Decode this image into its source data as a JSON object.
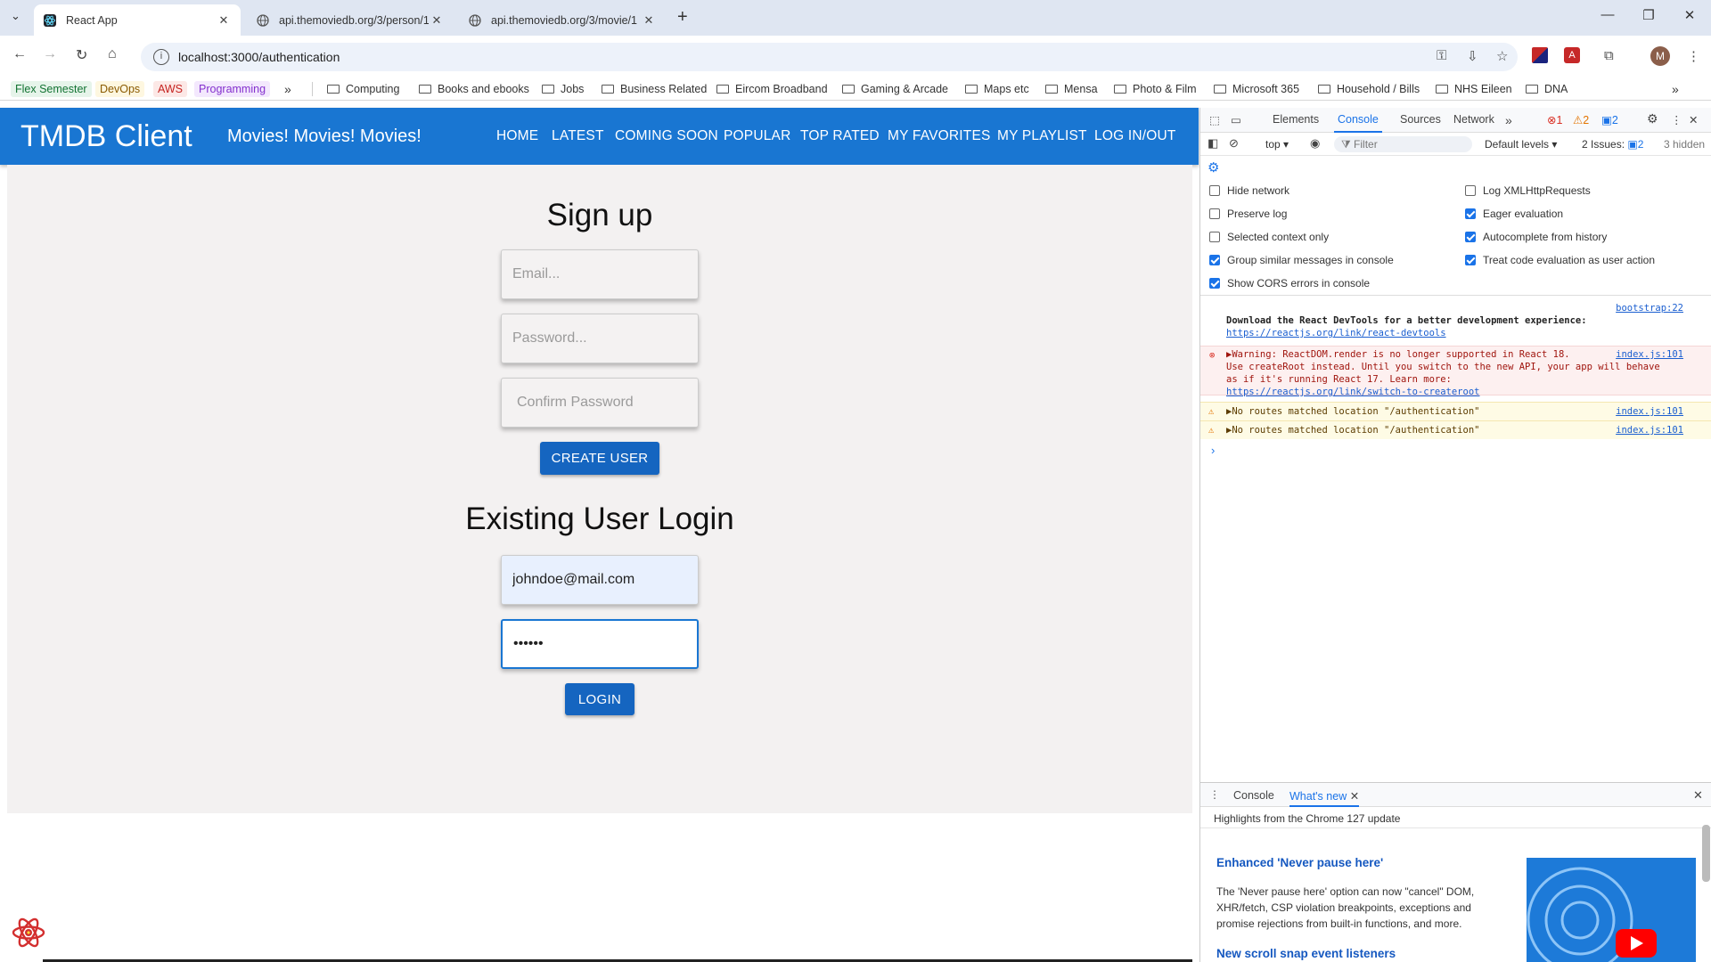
{
  "browser": {
    "tabs": [
      {
        "title": "React App",
        "active": true
      },
      {
        "title": "api.themoviedb.org/3/person/1",
        "active": false
      },
      {
        "title": "api.themoviedb.org/3/movie/1",
        "active": false
      }
    ],
    "url": "localhost:3000/authentication",
    "profile_initial": "M",
    "bookmarks": [
      {
        "label": "Flex Semester",
        "type": "chip",
        "color": "#e6f4ea",
        "text": "#137333"
      },
      {
        "label": "DevOps",
        "type": "chip",
        "color": "#fef7e0",
        "text": "#8a5a00"
      },
      {
        "label": "AWS",
        "type": "chip",
        "color": "#fce8e6",
        "text": "#c5221f"
      },
      {
        "label": "Programming",
        "type": "chip",
        "color": "#f3e8fd",
        "text": "#8430ce"
      },
      {
        "label": "Computing",
        "type": "folder"
      },
      {
        "label": "Books and ebooks",
        "type": "folder"
      },
      {
        "label": "Jobs",
        "type": "folder"
      },
      {
        "label": "Business Related",
        "type": "folder"
      },
      {
        "label": "Eircom Broadband",
        "type": "folder"
      },
      {
        "label": "Gaming & Arcade",
        "type": "folder"
      },
      {
        "label": "Maps etc",
        "type": "folder"
      },
      {
        "label": "Mensa",
        "type": "folder"
      },
      {
        "label": "Photo & Film",
        "type": "folder"
      },
      {
        "label": "Microsoft 365",
        "type": "folder"
      },
      {
        "label": "Household / Bills",
        "type": "folder"
      },
      {
        "label": "NHS Eileen",
        "type": "folder"
      },
      {
        "label": "DNA",
        "type": "folder"
      }
    ]
  },
  "app": {
    "brand": "TMDB Client",
    "tagline": "Movies! Movies! Movies!",
    "nav": [
      "HOME",
      "LATEST",
      "COMING SOON",
      "POPULAR",
      "TOP RATED",
      "MY FAVORITES",
      "MY PLAYLIST",
      "LOG IN/OUT"
    ],
    "header_color": "#1976d2",
    "signup": {
      "heading": "Sign up",
      "email_placeholder": "Email...",
      "password_placeholder": "Password...",
      "confirm_placeholder": "Confirm Password",
      "button": "CREATE USER"
    },
    "login": {
      "heading": "Existing User Login",
      "email_value": "johndoe@mail.com",
      "password_value": "••••••",
      "button": "LOGIN"
    }
  },
  "devtools": {
    "tabs": [
      "Elements",
      "Console",
      "Sources",
      "Network"
    ],
    "active_tab": "Console",
    "error_count": "1",
    "warning_count": "2",
    "info_count": "2",
    "context": "top",
    "filter_placeholder": "Filter",
    "levels": "Default levels",
    "issues_label": "2 Issues:",
    "issues_count": "2",
    "hidden": "3 hidden",
    "settings_left": [
      {
        "label": "Hide network",
        "checked": false
      },
      {
        "label": "Preserve log",
        "checked": false
      },
      {
        "label": "Selected context only",
        "checked": false
      },
      {
        "label": "Group similar messages in console",
        "checked": true
      },
      {
        "label": "Show CORS errors in console",
        "checked": true
      }
    ],
    "settings_right": [
      {
        "label": "Log XMLHttpRequests",
        "checked": false
      },
      {
        "label": "Eager evaluation",
        "checked": true
      },
      {
        "label": "Autocomplete from history",
        "checked": true
      },
      {
        "label": "Treat code evaluation as user action",
        "checked": true
      }
    ],
    "messages": {
      "info_line1": "Download the React DevTools for a better development experience:",
      "info_link": "https://reactjs.org/link/react-devtools",
      "info_src": "bootstrap:22",
      "error_line1": "▶Warning: ReactDOM.render is no longer supported in React 18.",
      "error_line2": "Use createRoot instead. Until you switch to the new API, your app will behave",
      "error_line3": "as if it's running React 17. Learn more:",
      "error_link": "https://reactjs.org/link/switch-to-createroot",
      "error_src": "index.js:101",
      "warn1": "▶No routes matched location \"/authentication\"",
      "warn1_src": "index.js:101",
      "warn2": "▶No routes matched location \"/authentication\"",
      "warn2_src": "index.js:101"
    },
    "drawer": {
      "tabs": [
        "Console",
        "What's new"
      ],
      "highlight": "Highlights from the Chrome 127 update",
      "item1_title": "Enhanced 'Never pause here'",
      "item1_text": "The 'Never pause here' option can now \"cancel\" DOM, XHR/fetch, CSP violation breakpoints, exceptions and promise rejections from built-in functions, and more.",
      "item2_title": "New scroll snap event listeners"
    }
  }
}
